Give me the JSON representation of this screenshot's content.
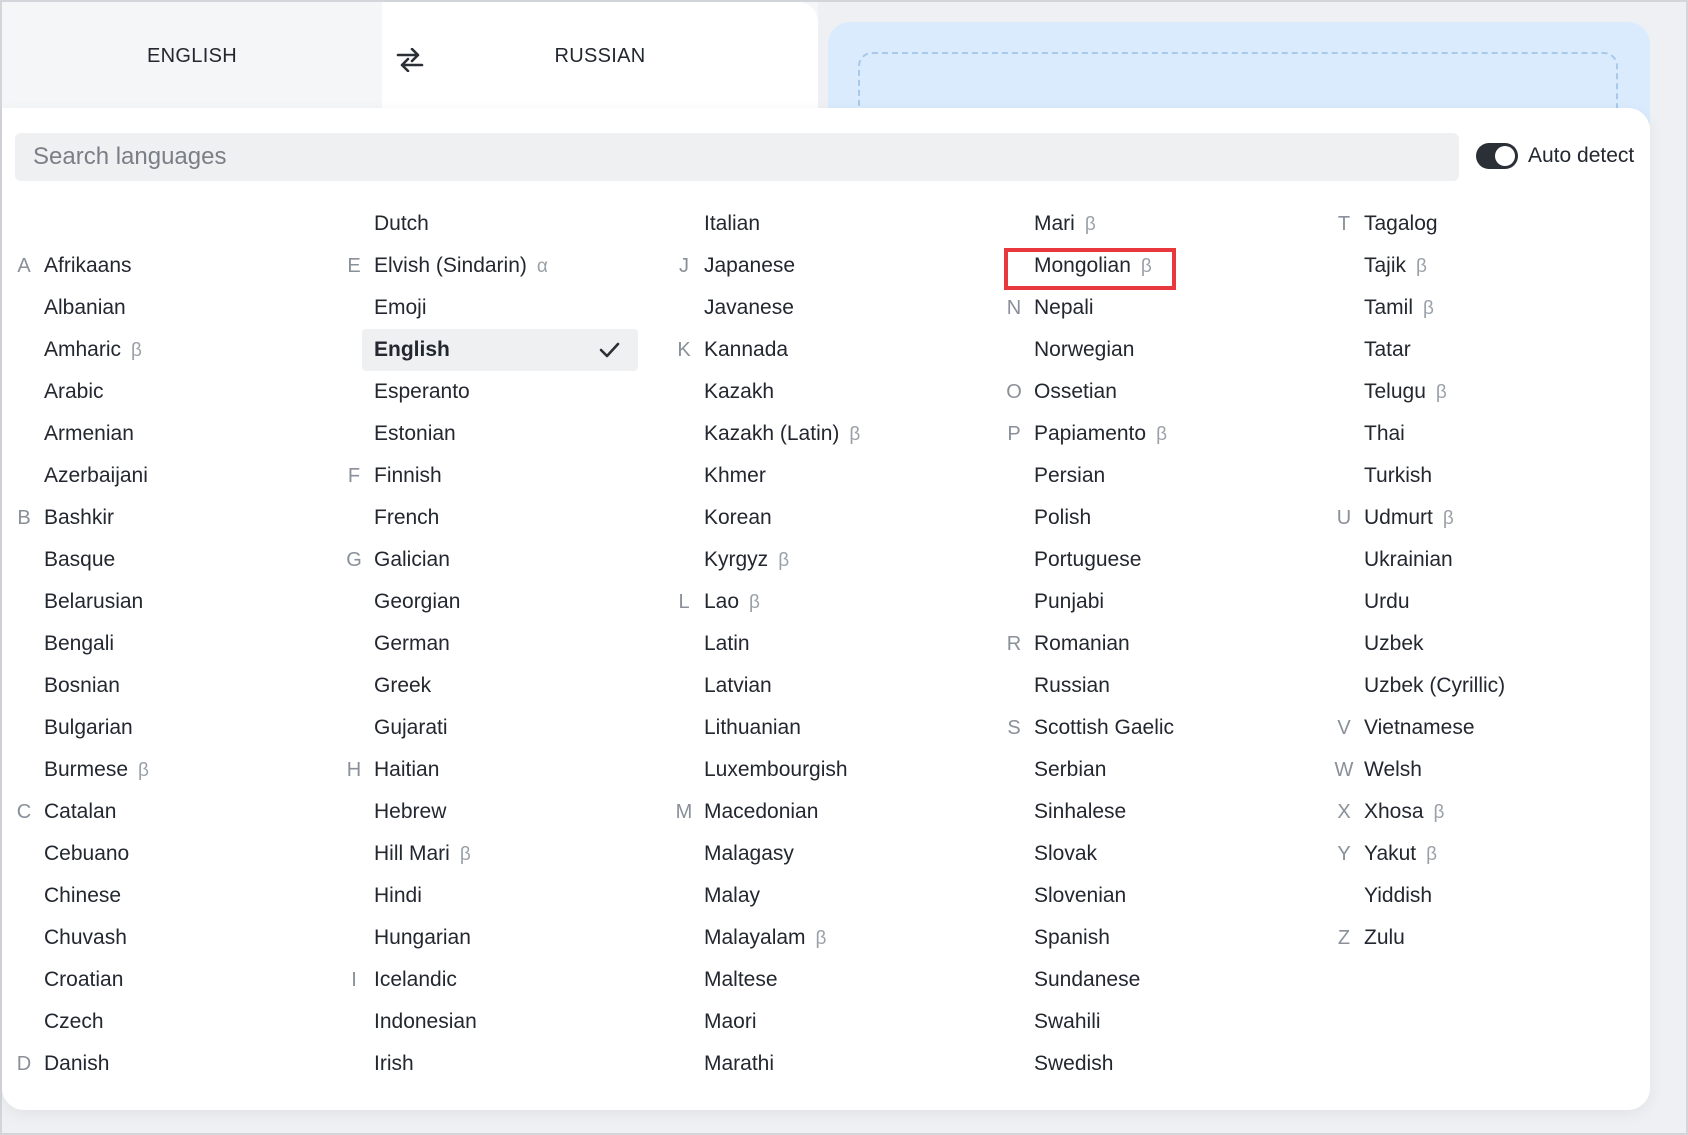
{
  "tabs": {
    "source": "ENGLISH",
    "target": "RUSSIAN"
  },
  "search": {
    "placeholder": "Search languages",
    "value": ""
  },
  "auto_detect": {
    "label": "Auto detect",
    "enabled": true
  },
  "selected_language": "English",
  "highlighted_language": "Mongolian",
  "columns": [
    [
      {
        "letter": "",
        "name": "",
        "badge": ""
      },
      {
        "letter": "A",
        "name": "Afrikaans",
        "badge": ""
      },
      {
        "letter": "",
        "name": "Albanian",
        "badge": ""
      },
      {
        "letter": "",
        "name": "Amharic",
        "badge": "β"
      },
      {
        "letter": "",
        "name": "Arabic",
        "badge": ""
      },
      {
        "letter": "",
        "name": "Armenian",
        "badge": ""
      },
      {
        "letter": "",
        "name": "Azerbaijani",
        "badge": ""
      },
      {
        "letter": "B",
        "name": "Bashkir",
        "badge": ""
      },
      {
        "letter": "",
        "name": "Basque",
        "badge": ""
      },
      {
        "letter": "",
        "name": "Belarusian",
        "badge": ""
      },
      {
        "letter": "",
        "name": "Bengali",
        "badge": ""
      },
      {
        "letter": "",
        "name": "Bosnian",
        "badge": ""
      },
      {
        "letter": "",
        "name": "Bulgarian",
        "badge": ""
      },
      {
        "letter": "",
        "name": "Burmese",
        "badge": "β"
      },
      {
        "letter": "C",
        "name": "Catalan",
        "badge": ""
      },
      {
        "letter": "",
        "name": "Cebuano",
        "badge": ""
      },
      {
        "letter": "",
        "name": "Chinese",
        "badge": ""
      },
      {
        "letter": "",
        "name": "Chuvash",
        "badge": ""
      },
      {
        "letter": "",
        "name": "Croatian",
        "badge": ""
      },
      {
        "letter": "",
        "name": "Czech",
        "badge": ""
      },
      {
        "letter": "D",
        "name": "Danish",
        "badge": ""
      }
    ],
    [
      {
        "letter": "",
        "name": "Dutch",
        "badge": ""
      },
      {
        "letter": "E",
        "name": "Elvish (Sindarin)",
        "badge": "α"
      },
      {
        "letter": "",
        "name": "Emoji",
        "badge": ""
      },
      {
        "letter": "",
        "name": "English",
        "badge": ""
      },
      {
        "letter": "",
        "name": "Esperanto",
        "badge": ""
      },
      {
        "letter": "",
        "name": "Estonian",
        "badge": ""
      },
      {
        "letter": "F",
        "name": "Finnish",
        "badge": ""
      },
      {
        "letter": "",
        "name": "French",
        "badge": ""
      },
      {
        "letter": "G",
        "name": "Galician",
        "badge": ""
      },
      {
        "letter": "",
        "name": "Georgian",
        "badge": ""
      },
      {
        "letter": "",
        "name": "German",
        "badge": ""
      },
      {
        "letter": "",
        "name": "Greek",
        "badge": ""
      },
      {
        "letter": "",
        "name": "Gujarati",
        "badge": ""
      },
      {
        "letter": "H",
        "name": "Haitian",
        "badge": ""
      },
      {
        "letter": "",
        "name": "Hebrew",
        "badge": ""
      },
      {
        "letter": "",
        "name": "Hill Mari",
        "badge": "β"
      },
      {
        "letter": "",
        "name": "Hindi",
        "badge": ""
      },
      {
        "letter": "",
        "name": "Hungarian",
        "badge": ""
      },
      {
        "letter": "I",
        "name": "Icelandic",
        "badge": ""
      },
      {
        "letter": "",
        "name": "Indonesian",
        "badge": ""
      },
      {
        "letter": "",
        "name": "Irish",
        "badge": ""
      }
    ],
    [
      {
        "letter": "",
        "name": "Italian",
        "badge": ""
      },
      {
        "letter": "J",
        "name": "Japanese",
        "badge": ""
      },
      {
        "letter": "",
        "name": "Javanese",
        "badge": ""
      },
      {
        "letter": "K",
        "name": "Kannada",
        "badge": ""
      },
      {
        "letter": "",
        "name": "Kazakh",
        "badge": ""
      },
      {
        "letter": "",
        "name": "Kazakh (Latin)",
        "badge": "β"
      },
      {
        "letter": "",
        "name": "Khmer",
        "badge": ""
      },
      {
        "letter": "",
        "name": "Korean",
        "badge": ""
      },
      {
        "letter": "",
        "name": "Kyrgyz",
        "badge": "β"
      },
      {
        "letter": "L",
        "name": "Lao",
        "badge": "β"
      },
      {
        "letter": "",
        "name": "Latin",
        "badge": ""
      },
      {
        "letter": "",
        "name": "Latvian",
        "badge": ""
      },
      {
        "letter": "",
        "name": "Lithuanian",
        "badge": ""
      },
      {
        "letter": "",
        "name": "Luxembourgish",
        "badge": ""
      },
      {
        "letter": "M",
        "name": "Macedonian",
        "badge": ""
      },
      {
        "letter": "",
        "name": "Malagasy",
        "badge": ""
      },
      {
        "letter": "",
        "name": "Malay",
        "badge": ""
      },
      {
        "letter": "",
        "name": "Malayalam",
        "badge": "β"
      },
      {
        "letter": "",
        "name": "Maltese",
        "badge": ""
      },
      {
        "letter": "",
        "name": "Maori",
        "badge": ""
      },
      {
        "letter": "",
        "name": "Marathi",
        "badge": ""
      }
    ],
    [
      {
        "letter": "",
        "name": "Mari",
        "badge": "β"
      },
      {
        "letter": "",
        "name": "Mongolian",
        "badge": "β"
      },
      {
        "letter": "N",
        "name": "Nepali",
        "badge": ""
      },
      {
        "letter": "",
        "name": "Norwegian",
        "badge": ""
      },
      {
        "letter": "O",
        "name": "Ossetian",
        "badge": ""
      },
      {
        "letter": "P",
        "name": "Papiamento",
        "badge": "β"
      },
      {
        "letter": "",
        "name": "Persian",
        "badge": ""
      },
      {
        "letter": "",
        "name": "Polish",
        "badge": ""
      },
      {
        "letter": "",
        "name": "Portuguese",
        "badge": ""
      },
      {
        "letter": "",
        "name": "Punjabi",
        "badge": ""
      },
      {
        "letter": "R",
        "name": "Romanian",
        "badge": ""
      },
      {
        "letter": "",
        "name": "Russian",
        "badge": ""
      },
      {
        "letter": "S",
        "name": "Scottish Gaelic",
        "badge": ""
      },
      {
        "letter": "",
        "name": "Serbian",
        "badge": ""
      },
      {
        "letter": "",
        "name": "Sinhalese",
        "badge": ""
      },
      {
        "letter": "",
        "name": "Slovak",
        "badge": ""
      },
      {
        "letter": "",
        "name": "Slovenian",
        "badge": ""
      },
      {
        "letter": "",
        "name": "Spanish",
        "badge": ""
      },
      {
        "letter": "",
        "name": "Sundanese",
        "badge": ""
      },
      {
        "letter": "",
        "name": "Swahili",
        "badge": ""
      },
      {
        "letter": "",
        "name": "Swedish",
        "badge": ""
      }
    ],
    [
      {
        "letter": "T",
        "name": "Tagalog",
        "badge": ""
      },
      {
        "letter": "",
        "name": "Tajik",
        "badge": "β"
      },
      {
        "letter": "",
        "name": "Tamil",
        "badge": "β"
      },
      {
        "letter": "",
        "name": "Tatar",
        "badge": ""
      },
      {
        "letter": "",
        "name": "Telugu",
        "badge": "β"
      },
      {
        "letter": "",
        "name": "Thai",
        "badge": ""
      },
      {
        "letter": "",
        "name": "Turkish",
        "badge": ""
      },
      {
        "letter": "U",
        "name": "Udmurt",
        "badge": "β"
      },
      {
        "letter": "",
        "name": "Ukrainian",
        "badge": ""
      },
      {
        "letter": "",
        "name": "Urdu",
        "badge": ""
      },
      {
        "letter": "",
        "name": "Uzbek",
        "badge": ""
      },
      {
        "letter": "",
        "name": "Uzbek (Cyrillic)",
        "badge": ""
      },
      {
        "letter": "V",
        "name": "Vietnamese",
        "badge": ""
      },
      {
        "letter": "W",
        "name": "Welsh",
        "badge": ""
      },
      {
        "letter": "X",
        "name": "Xhosa",
        "badge": "β"
      },
      {
        "letter": "Y",
        "name": "Yakut",
        "badge": "β"
      },
      {
        "letter": "",
        "name": "Yiddish",
        "badge": ""
      },
      {
        "letter": "Z",
        "name": "Zulu",
        "badge": ""
      }
    ]
  ]
}
